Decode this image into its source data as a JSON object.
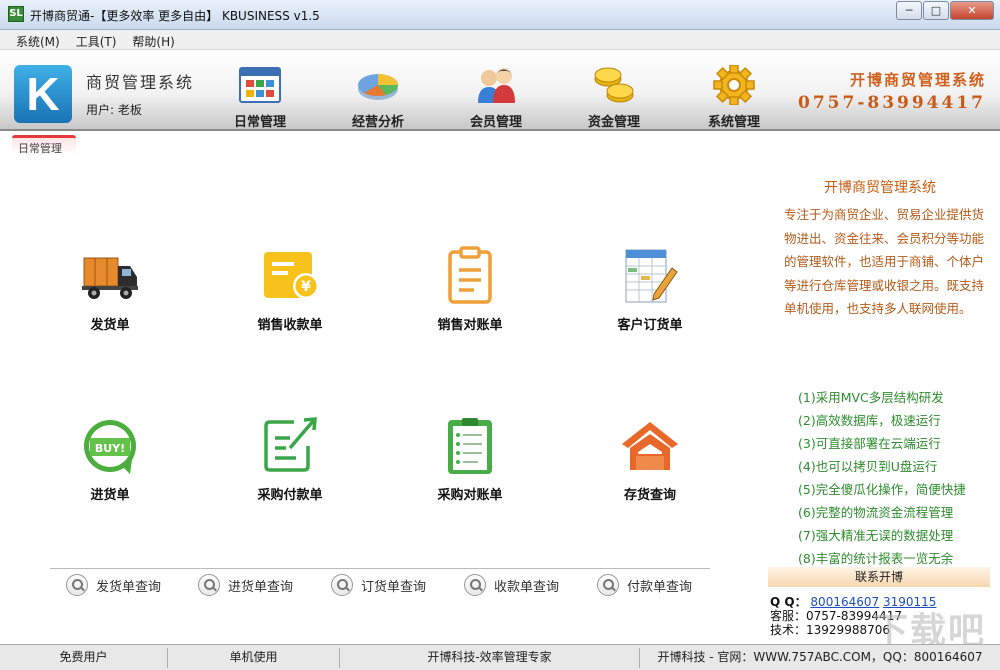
{
  "window": {
    "title": "开博商贸通-【更多效率 更多自由】  KBUSINESS v1.5",
    "app_icon_text": "SL"
  },
  "menu": [
    "系统(M)",
    "工具(T)",
    "帮助(H)"
  ],
  "header": {
    "system_name": "商贸管理系统",
    "user_label": "用户: 老板",
    "nav": [
      {
        "label": "日常管理",
        "icon": "calendar-icon"
      },
      {
        "label": "经营分析",
        "icon": "pie-chart-icon"
      },
      {
        "label": "会员管理",
        "icon": "members-icon"
      },
      {
        "label": "资金管理",
        "icon": "coins-icon"
      },
      {
        "label": "系统管理",
        "icon": "gear-icon"
      }
    ],
    "brand_name": "开博商贸管理系统",
    "brand_phone": "0757-83994417"
  },
  "tab": "日常管理",
  "tiles": [
    {
      "label": "发货单",
      "icon": "truck-icon"
    },
    {
      "label": "销售收款单",
      "icon": "receipt-yen-icon"
    },
    {
      "label": "销售对账单",
      "icon": "clipboard-icon"
    },
    {
      "label": "客户订货单",
      "icon": "order-sheet-icon"
    },
    {
      "label": "进货单",
      "icon": "buy-badge-icon"
    },
    {
      "label": "采购付款单",
      "icon": "edit-document-icon"
    },
    {
      "label": "采购对账单",
      "icon": "checklist-clipboard-icon"
    },
    {
      "label": "存货查询",
      "icon": "warehouse-icon"
    }
  ],
  "queries": [
    "发货单查询",
    "进货单查询",
    "订货单查询",
    "收款单查询",
    "付款单查询"
  ],
  "right_panel": {
    "title": "开博商贸管理系统",
    "description": "专注于为商贸企业、贸易企业提供货物进出、资金往来、会员积分等功能的管理软件，也适用于商铺、个体户等进行仓库管理或收银之用。既支持单机使用，也支持多人联网使用。",
    "features": [
      "(1)采用MVC多层结构研发",
      "(2)高效数据库，极速运行",
      "(3)可直接部署在云端运行",
      "(4)也可以拷贝到U盘运行",
      "(5)完全傻瓜化操作，简便快捷",
      "(6)完整的物流资金流程管理",
      "(7)强大精准无误的数据处理",
      "(8)丰富的统计报表一览无余"
    ],
    "contact_title": "联系开博",
    "qq_label": "Q Q：",
    "qq1": "800164607",
    "qq2": "3190115",
    "service_label": "客服：",
    "service_phone": "0757-83994417",
    "tech_label": "技术：",
    "tech_phone": "13929988706"
  },
  "statusbar": [
    "免费用户",
    "单机使用",
    "开博科技-效率管理专家",
    "开博科技 - 官网：WWW.757ABC.COM，QQ：800164607"
  ],
  "watermark": "下载吧"
}
